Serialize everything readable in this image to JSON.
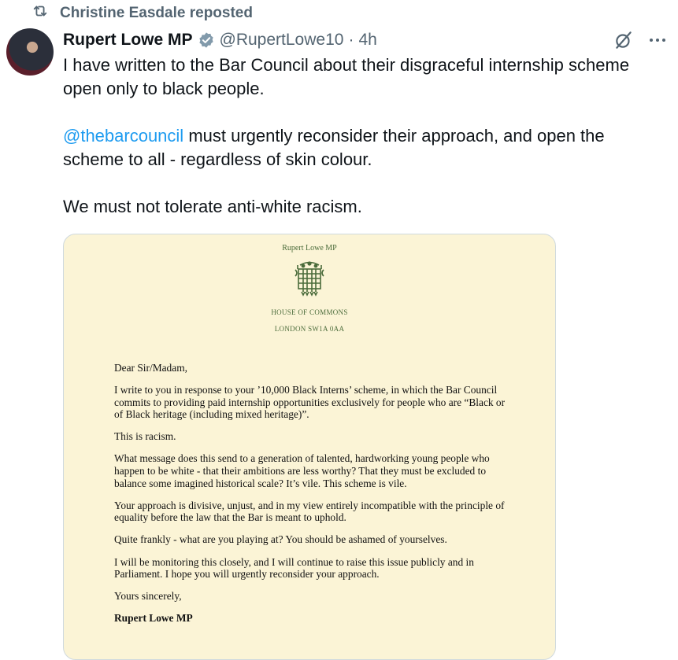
{
  "repost": {
    "icon": "repost-icon",
    "text": "Christine Easdale reposted"
  },
  "author": {
    "name": "Rupert Lowe MP",
    "handle": "@RupertLowe10",
    "separator": "·",
    "time": "4h",
    "verified_icon": "verified-badge-icon",
    "verified_color": "#829aab"
  },
  "actions": {
    "grok_icon": "grok-icon",
    "more_icon": "more-icon"
  },
  "tweet": {
    "line1": "I have written to the Bar Council about their disgraceful internship scheme open only to black people.",
    "mention": "@thebarcouncil",
    "line2": " must urgently reconsider their approach, and open the scheme to all - regardless of skin colour.",
    "line3": "We must not tolerate anti-white racism.",
    "mention_color": "#1d9bf0"
  },
  "letter": {
    "letterhead_name": "Rupert Lowe MP",
    "crest_icon": "portcullis-icon",
    "house": "HOUSE OF COMMONS",
    "address": "LONDON SW1A 0AA",
    "greeting": "Dear Sir/Madam,",
    "para1": "I write to you in response to your ’10,000 Black Interns’ scheme, in which the Bar Council commits to providing paid internship opportunities exclusively for people who are “Black or of Black heritage (including mixed heritage)”.",
    "para2": "This is racism.",
    "para3": "What message does this send to a generation of talented, hardworking young people who happen to be white - that their ambitions are less worthy? That they must be excluded to balance some imagined historical scale? It’s vile. This scheme is vile.",
    "para4": "Your approach is divisive, unjust, and in my view entirely incompatible with the principle of equality before the law that the Bar is meant to uphold.",
    "para5": "Quite frankly - what are you playing at? You should be ashamed of yourselves.",
    "para6": "I will be monitoring this closely, and I will continue to raise this issue publicly and in Parliament. I hope you will urgently reconsider your approach.",
    "closing": "Yours sincerely,",
    "signature": "Rupert Lowe MP",
    "paper_color": "#fbf4d6",
    "ink_green": "#4a6b3a"
  }
}
